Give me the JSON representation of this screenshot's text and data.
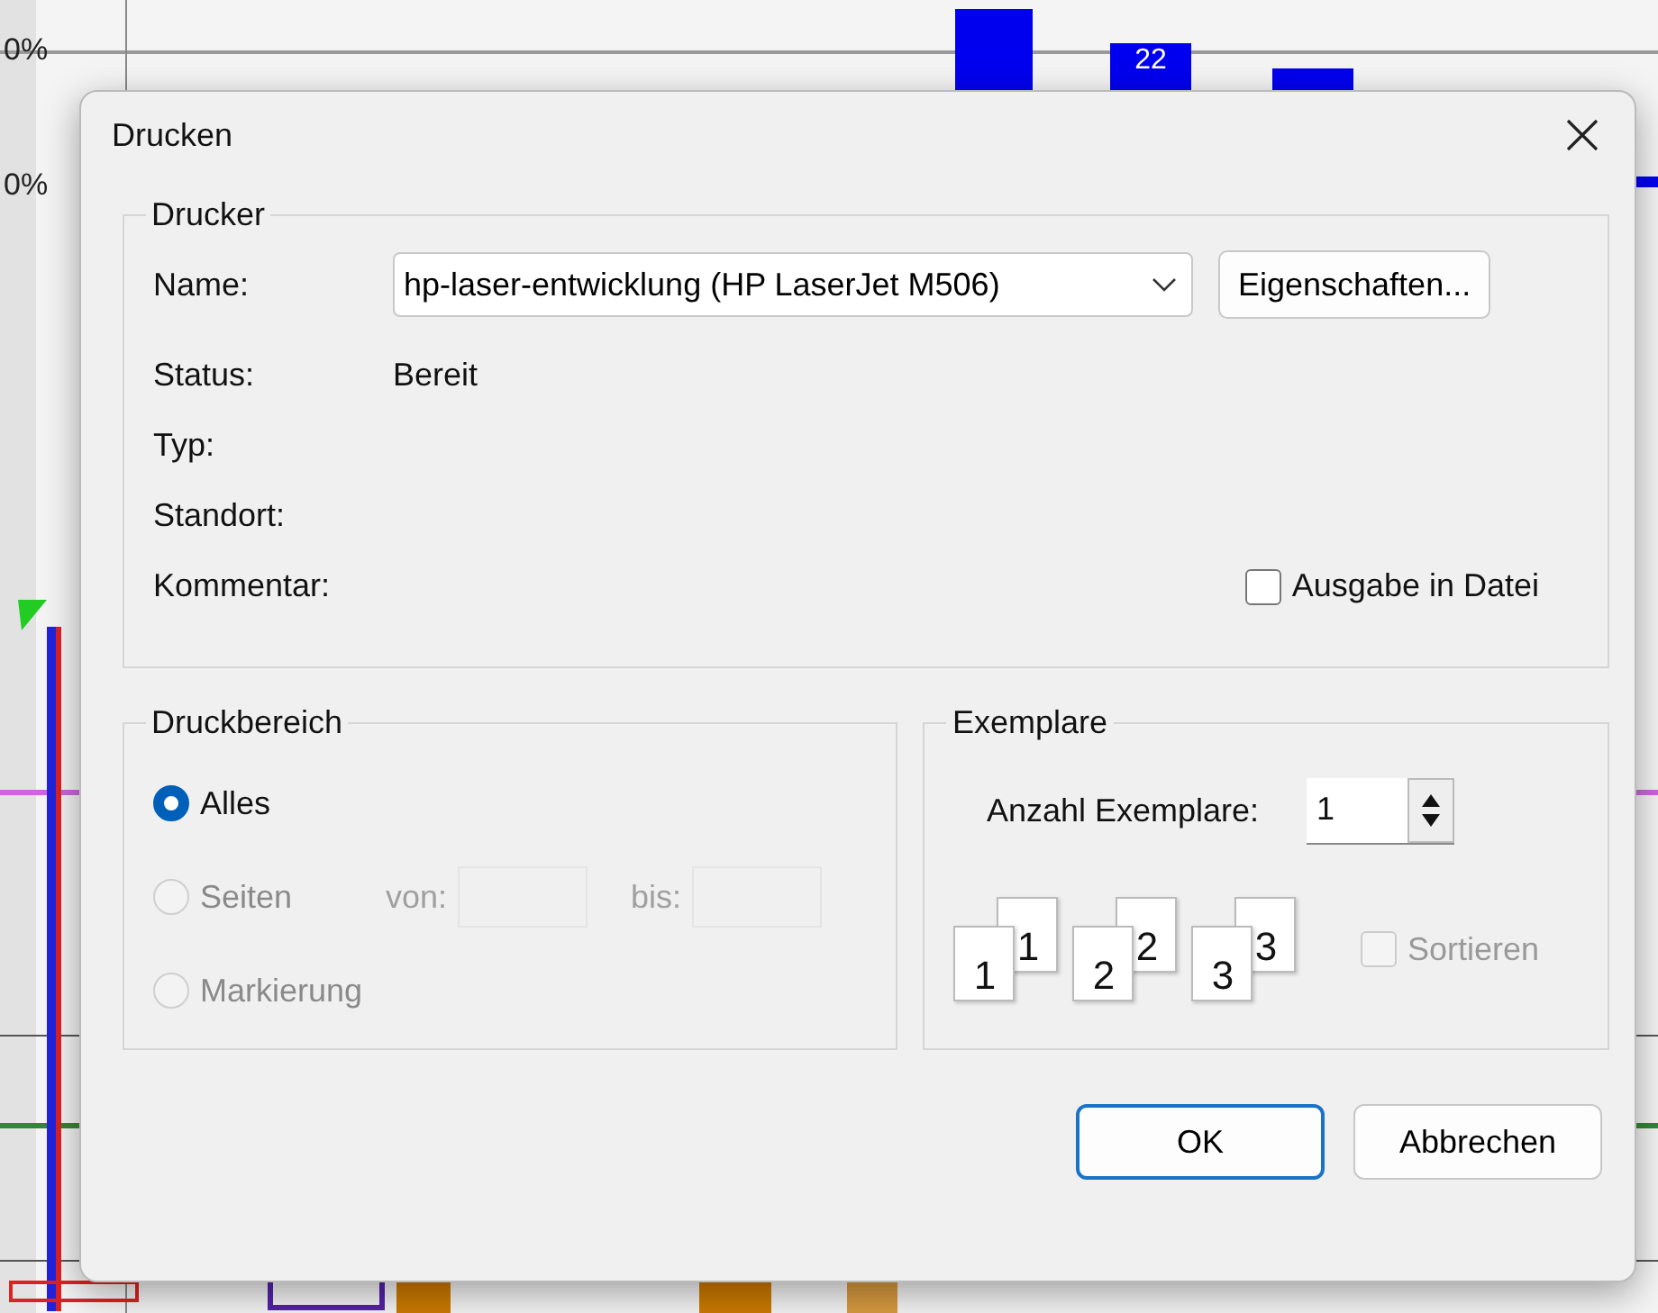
{
  "background": {
    "axis_labels": [
      "0%",
      "0%"
    ],
    "bar_labels": [
      "22"
    ]
  },
  "dialog": {
    "title": "Drucken"
  },
  "printer_group": {
    "title": "Drucker",
    "name_label": "Name:",
    "name_value": "hp-laser-entwicklung (HP LaserJet M506)",
    "properties_button": "Eigenschaften...",
    "fields": [
      {
        "label": "Status:",
        "value": "Bereit"
      },
      {
        "label": "Typ:"
      },
      {
        "label": "Standort:"
      },
      {
        "label": "Kommentar:"
      }
    ],
    "print_to_file": {
      "label": "Ausgabe in Datei",
      "checked": false
    }
  },
  "range_group": {
    "title": "Druckbereich",
    "from_label": "von:",
    "to_label": "bis:",
    "options": [
      {
        "label": "Alles",
        "selected": true,
        "disabled": false
      },
      {
        "label": "Seiten",
        "selected": false,
        "disabled": true
      },
      {
        "label": "Markierung",
        "selected": false,
        "disabled": true
      }
    ]
  },
  "copies_group": {
    "title": "Exemplare",
    "count_label": "Anzahl Exemplare:",
    "count_value": "1",
    "collate_icons": [
      {
        "front": "1",
        "back": "1"
      },
      {
        "front": "2",
        "back": "2"
      },
      {
        "front": "3",
        "back": "3"
      }
    ],
    "collate": {
      "label": "Sortieren",
      "checked": false,
      "disabled": true
    }
  },
  "buttons": [
    {
      "label": "OK",
      "default": true
    },
    {
      "label": "Abbrechen",
      "default": false
    }
  ]
}
